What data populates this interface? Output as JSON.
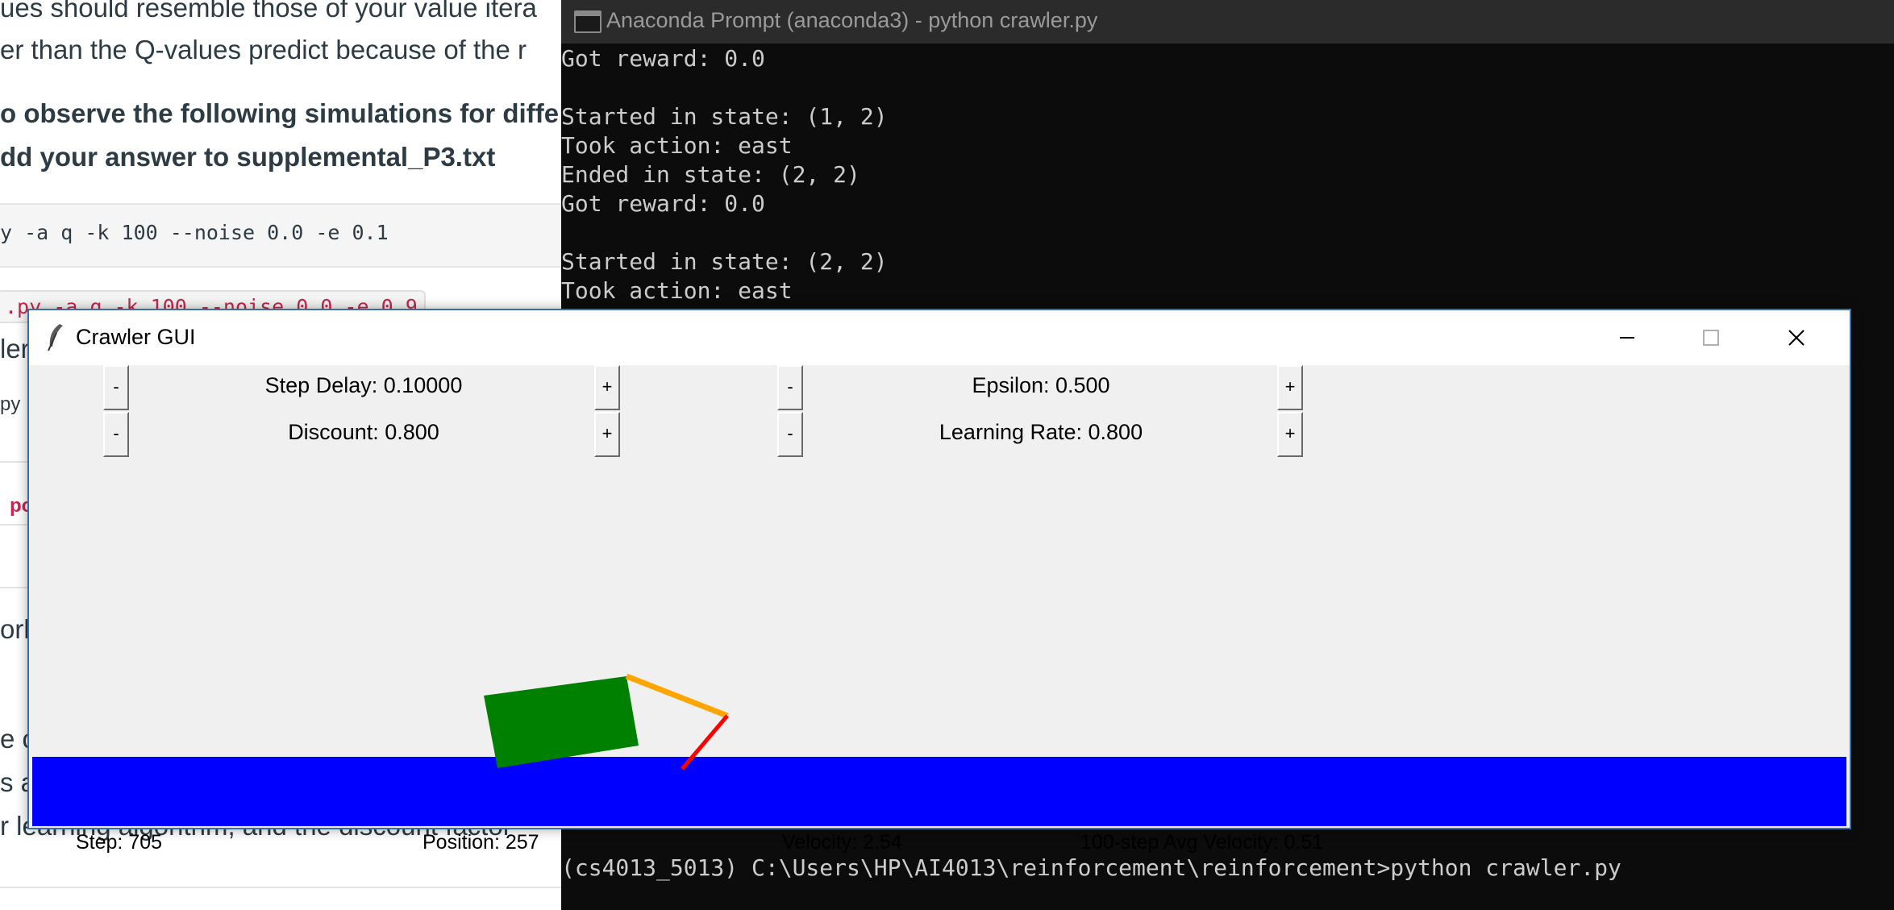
{
  "webpage": {
    "line1": "ues should resemble those of your value itera",
    "line2": "er than the Q-values predict because of the r",
    "bold1": "o observe the following simulations for diffe",
    "bold2": "dd your answer to supplemental_P3.txt",
    "code1": "y -a q -k 100 --noise 0.0 -e 0.1",
    "code2": ".py -a q -k 100 --noise 0.0 -e 0.9",
    "frag_ler": "ler",
    "frag_py": "py",
    "frag_po": "po",
    "frag_orl": "orl",
    "frag_ec": "e c",
    "frag_sa": "s a",
    "last_line": "r learning algorithm, and the discount factor"
  },
  "console": {
    "title": "Anaconda Prompt (anaconda3) - python  crawler.py",
    "lines": [
      "Got reward: 0.0",
      "",
      "Started in state: (1, 2)",
      "Took action: east",
      "Ended in state: (2, 2)",
      "Got reward: 0.0",
      "",
      "Started in state: (2, 2)",
      "Took action: east"
    ],
    "prompt_line": "(cs4013_5013) C:\\Users\\HP\\AI4013\\reinforcement\\reinforcement>python crawler.py"
  },
  "crawler": {
    "title": "Crawler GUI",
    "minus": "-",
    "plus": "+",
    "step_delay": "Step Delay: 0.10000",
    "discount": "Discount: 0.800",
    "epsilon": "Epsilon: 0.500",
    "learning_rate": "Learning Rate: 0.800",
    "stats": {
      "step": "Step: 705",
      "position": "Position: 257",
      "velocity": "Velocity: 2.54",
      "avg_velocity": "100-step Avg Velocity: 0.51"
    },
    "colors": {
      "body": "#008000",
      "arm": "#ffa500",
      "hand": "#ff0000",
      "ground": "#0000ff"
    }
  }
}
